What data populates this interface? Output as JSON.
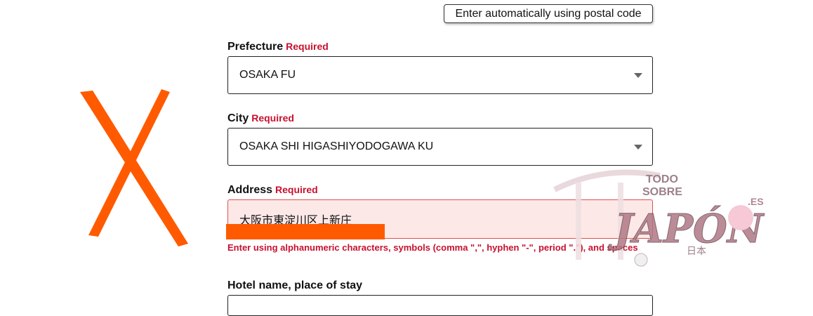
{
  "postal": {
    "button_label": "Enter automatically using postal code"
  },
  "required_label": "Required",
  "fields": {
    "prefecture": {
      "label": "Prefecture",
      "value": "OSAKA FU"
    },
    "city": {
      "label": "City",
      "value": "OSAKA SHI HIGASHIYODOGAWA KU"
    },
    "address": {
      "label": "Address",
      "value": "大阪市東淀川区上新庄",
      "error": "Enter using alphanumeric characters, symbols (comma \",\", hyphen \"-\", period \".\"), and spaces"
    },
    "hotel": {
      "label": "Hotel name, place of stay",
      "value": ""
    }
  },
  "watermark": {
    "line1": "TODO",
    "line2": "SOBRE",
    "main": "JAPÓN",
    "suffix": ".ES",
    "kanji": "日本"
  },
  "colors": {
    "required": "#c8102e",
    "error_bg": "#fde8e8",
    "error_border": "#d9534f",
    "orange_mark": "#ff5a00"
  }
}
